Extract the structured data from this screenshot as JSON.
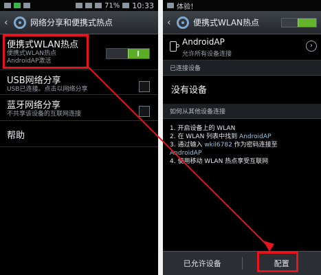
{
  "left_screen": {
    "status_bar": {
      "battery": "71%",
      "time": "10:33"
    },
    "title": "网络分享和便携式热点",
    "items": [
      {
        "title": "便携式WLAN热点",
        "subtitle_lines": [
          "便携式WLAN热点",
          "AndroidAP激活"
        ],
        "control": "toggle",
        "state": "on"
      },
      {
        "title": "USB网络分享",
        "subtitle_lines": [
          "USB已连接。点击以网络分享"
        ],
        "control": "checkbox",
        "state": "unchecked"
      },
      {
        "title": "蓝牙网络分享",
        "subtitle_lines": [
          "不共享该设备的互联网连接"
        ],
        "control": "checkbox",
        "state": "unchecked"
      },
      {
        "title": "帮助",
        "subtitle_lines": []
      }
    ]
  },
  "right_screen": {
    "status_bar": {
      "notice": "体验！"
    },
    "title": "便携式WLAN热点",
    "hotspot": {
      "name": "AndroidAP",
      "subtitle": "允许所有设备连接"
    },
    "connected_header": "已连接设备",
    "no_device": "没有设备",
    "how_header": "如何从其他设备连接",
    "steps": {
      "s1": "1. 开启设备上的 WLAN",
      "s2_pre": "2. 在 WLAN 列表中找到 ",
      "s2_link": "AndroidAP",
      "s3_pre": "3. 通过输入 ",
      "s3_link": "wkil6782",
      "s3_post": " 作为密码连接至",
      "s3_line2": "AndroidAP",
      "s4": "4. 使用移动 WLAN 热点享受互联网"
    },
    "buttons": {
      "allowed_devices": "已允许设备",
      "configure": "配置"
    }
  },
  "colors": {
    "highlight": "#e6151b",
    "toggle_on": "#5cae28",
    "link": "#9ec3e0"
  }
}
